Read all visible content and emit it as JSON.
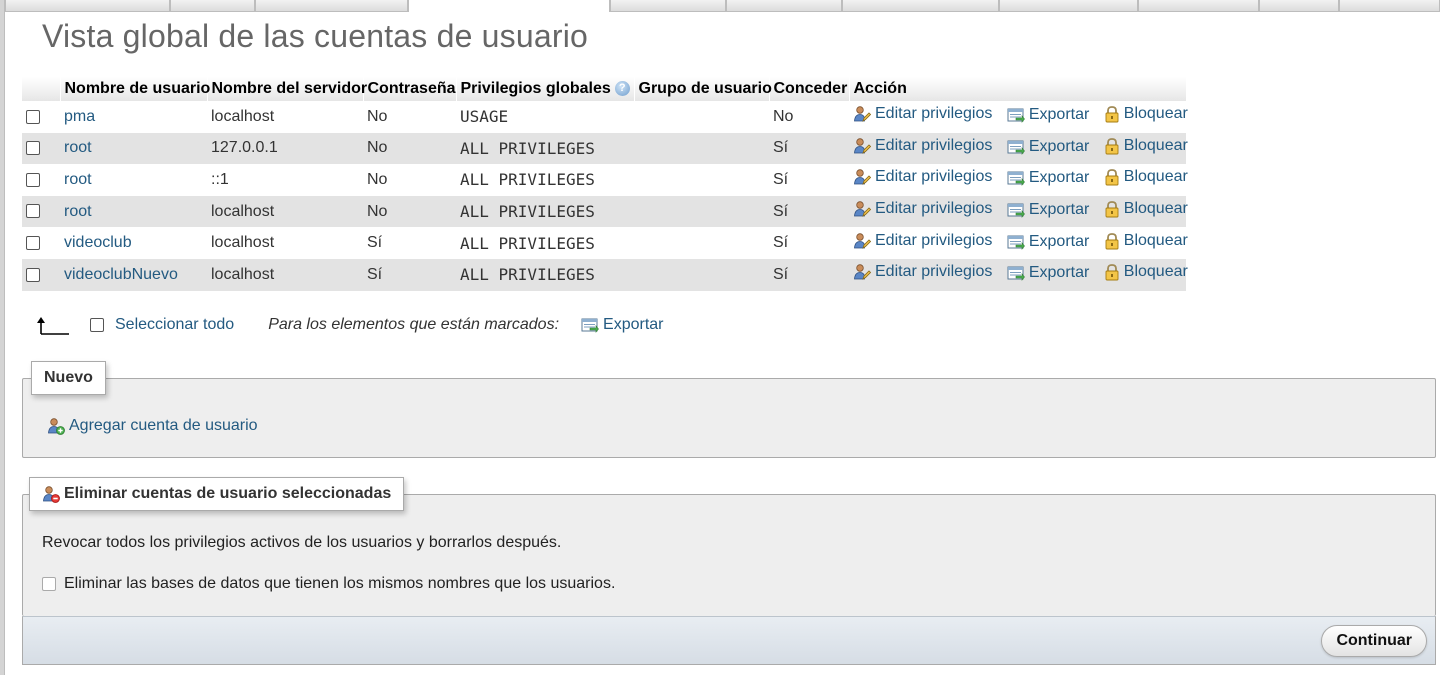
{
  "page_title": "Vista global de las cuentas de usuario",
  "table": {
    "headers": [
      "Nombre de usuario",
      "Nombre del servidor",
      "Contraseña",
      "Privilegios globales",
      "Grupo de usuario",
      "Conceder",
      "Acción"
    ],
    "rows": [
      {
        "user": "pma",
        "host": "localhost",
        "password": "No",
        "privileges": "USAGE",
        "group": "",
        "grant": "No"
      },
      {
        "user": "root",
        "host": "127.0.0.1",
        "password": "No",
        "privileges": "ALL PRIVILEGES",
        "group": "",
        "grant": "Sí"
      },
      {
        "user": "root",
        "host": "::1",
        "password": "No",
        "privileges": "ALL PRIVILEGES",
        "group": "",
        "grant": "Sí"
      },
      {
        "user": "root",
        "host": "localhost",
        "password": "No",
        "privileges": "ALL PRIVILEGES",
        "group": "",
        "grant": "Sí"
      },
      {
        "user": "videoclub",
        "host": "localhost",
        "password": "Sí",
        "privileges": "ALL PRIVILEGES",
        "group": "",
        "grant": "Sí"
      },
      {
        "user": "videoclubNuevo",
        "host": "localhost",
        "password": "Sí",
        "privileges": "ALL PRIVILEGES",
        "group": "",
        "grant": "Sí"
      }
    ],
    "actions": {
      "edit": "Editar privilegios",
      "export": "Exportar",
      "lock": "Bloquear"
    }
  },
  "bulk": {
    "select_all": "Seleccionar todo",
    "with_selected": "Para los elementos que están marcados:",
    "export": "Exportar"
  },
  "new_section": {
    "legend": "Nuevo",
    "add_user": "Agregar cuenta de usuario"
  },
  "delete_section": {
    "legend": "Eliminar cuentas de usuario seleccionadas",
    "description": "Revocar todos los privilegios activos de los usuarios y borrarlos después.",
    "drop_db_label": "Eliminar las bases de datos que tienen los mismos nombres que los usuarios.",
    "continue": "Continuar"
  },
  "colors": {
    "link": "#235a81",
    "no_password": "#d20000",
    "row_alt": "#e3e3e3",
    "fieldset_bg": "#eeeeee"
  },
  "icons": {
    "help": "help-icon",
    "edit": "user-edit-icon",
    "export": "export-icon",
    "lock": "lock-icon",
    "add_user": "user-add-icon",
    "delete_user": "user-delete-icon",
    "arrow": "arrow-left-up-icon"
  }
}
